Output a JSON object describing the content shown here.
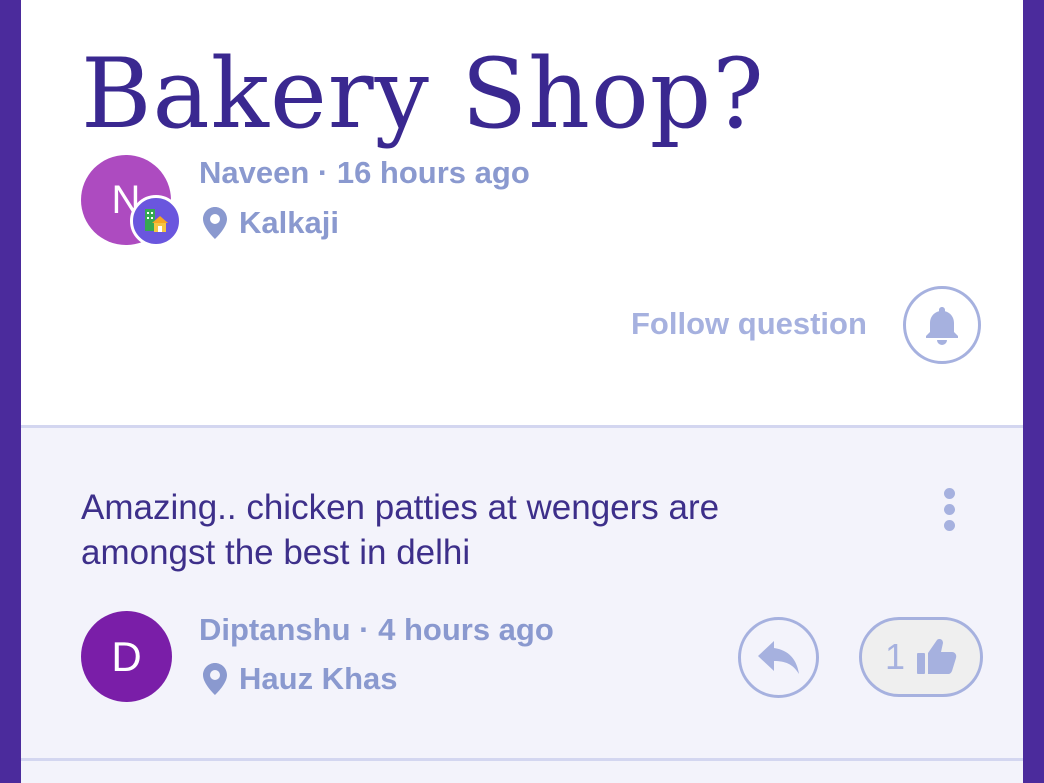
{
  "question": {
    "title": "Bakery Shop?",
    "author": {
      "initial": "N",
      "name_time": "Naveen · 16 hours ago",
      "location": "Kalkaji",
      "badge_icon": "home-building-icon"
    },
    "follow_label": "Follow question",
    "follow_icon": "bell-icon"
  },
  "answer": {
    "text": "Amazing.. chicken patties at wengers are amongst the best in delhi",
    "author": {
      "initial": "D",
      "name_time": "Diptanshu · 4 hours ago",
      "location": "Hauz Khas"
    },
    "like_count": "1",
    "reply_icon": "reply-icon",
    "like_icon": "thumbs-up-icon",
    "more_icon": "more-vertical-icon"
  },
  "colors": {
    "brand_purple": "#4b2b9c",
    "title": "#3a2890",
    "meta": "#8a99cf",
    "accent_light": "#a6b1df",
    "avatar_n": "#ad4bc0",
    "avatar_d": "#7a1ea8"
  }
}
